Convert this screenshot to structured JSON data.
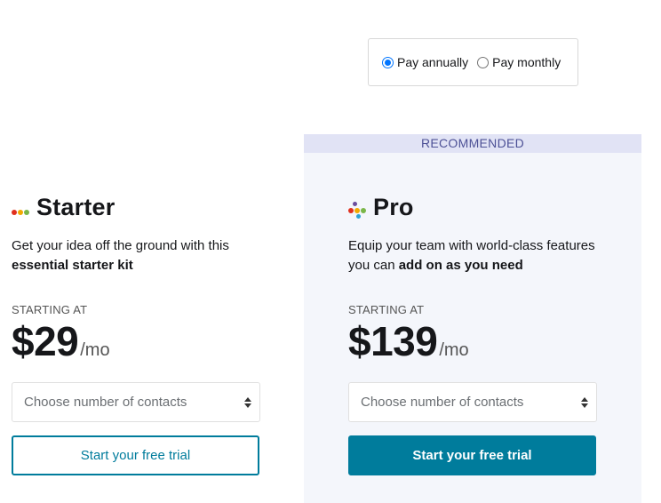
{
  "billing": {
    "options": [
      {
        "label": "Pay annually",
        "checked": true
      },
      {
        "label": "Pay monthly",
        "checked": false
      }
    ]
  },
  "recommended_label": "RECOMMENDED",
  "plans": {
    "starter": {
      "name": "Starter",
      "desc_plain": "Get your idea off the ground with this ",
      "desc_bold": "essential starter kit",
      "starting_at": "STARTING AT",
      "price": "$29",
      "per": "/mo",
      "select_placeholder": "Choose number of contacts",
      "cta": "Start your free trial",
      "logo_colors": [
        "#e0301e",
        "#f2a900",
        "#7ab648"
      ]
    },
    "pro": {
      "name": "Pro",
      "desc_plain": "Equip your team with world-class features you can ",
      "desc_bold": "add on as you need",
      "starting_at": "STARTING AT",
      "price": "$139",
      "per": "/mo",
      "select_placeholder": "Choose number of contacts",
      "cta": "Start your free trial",
      "logo_colors": [
        "#e0301e",
        "#f2a900",
        "#7ab648",
        "#2ea3d5",
        "#6a4c9c"
      ]
    }
  },
  "colors": {
    "accent": "#007c9c",
    "recommended_bg": "#e1e3f5",
    "panel_bg": "#f4f6fb"
  }
}
